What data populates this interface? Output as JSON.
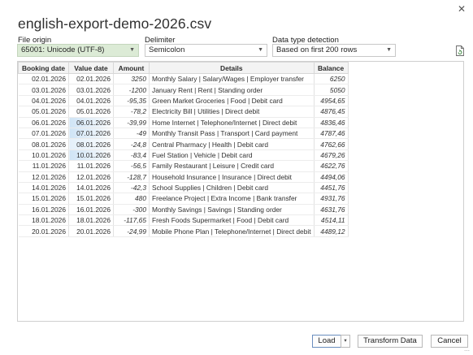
{
  "window": {
    "title": "english-export-demo-2026.csv",
    "close_glyph": "✕"
  },
  "file_origin": {
    "label": "File origin",
    "value": "65001: Unicode (UTF-8)"
  },
  "delimiter": {
    "label": "Delimiter",
    "value": "Semicolon"
  },
  "detection": {
    "label": "Data type detection",
    "value": "Based on first 200 rows"
  },
  "refresh_icon": "document-refresh-icon",
  "table": {
    "headers": [
      "Booking date",
      "Value date",
      "Amount",
      "Details",
      "Balance"
    ],
    "rows": [
      [
        "02.01.2026",
        "02.01.2026",
        "3250",
        "Monthly Salary | Salary/Wages | Employer transfer",
        "6250"
      ],
      [
        "03.01.2026",
        "03.01.2026",
        "-1200",
        "January Rent | Rent | Standing order",
        "5050"
      ],
      [
        "04.01.2026",
        "04.01.2026",
        "-95,35",
        "Green Market Groceries | Food | Debit card",
        "4954,65"
      ],
      [
        "05.01.2026",
        "05.01.2026",
        "-78,2",
        "Electricity Bill | Utilities | Direct debit",
        "4876,45"
      ],
      [
        "06.01.2026",
        "06.01.2026",
        "-39,99",
        "Home Internet | Telephone/Internet | Direct debit",
        "4836,46"
      ],
      [
        "07.01.2026",
        "07.01.2026",
        "-49",
        "Monthly Transit Pass | Transport | Card payment",
        "4787,46"
      ],
      [
        "08.01.2026",
        "08.01.2026",
        "-24,8",
        "Central Pharmacy | Health | Debit card",
        "4762,66"
      ],
      [
        "10.01.2026",
        "10.01.2026",
        "-83,4",
        "Fuel Station | Vehicle | Debit card",
        "4679,26"
      ],
      [
        "11.01.2026",
        "11.01.2026",
        "-56,5",
        "Family Restaurant | Leisure | Credit card",
        "4622,76"
      ],
      [
        "12.01.2026",
        "12.01.2026",
        "-128,7",
        "Household Insurance | Insurance | Direct debit",
        "4494,06"
      ],
      [
        "14.01.2026",
        "14.01.2026",
        "-42,3",
        "School Supplies | Children | Debit card",
        "4451,76"
      ],
      [
        "15.01.2026",
        "15.01.2026",
        "480",
        "Freelance Project | Extra Income | Bank transfer",
        "4931,76"
      ],
      [
        "16.01.2026",
        "16.01.2026",
        "-300",
        "Monthly Savings | Savings | Standing order",
        "4631,76"
      ],
      [
        "18.01.2026",
        "18.01.2026",
        "-117,65",
        "Fresh Foods Supermarket | Food | Debit card",
        "4514,11"
      ],
      [
        "20.01.2026",
        "20.01.2026",
        "-24,99",
        "Mobile Phone Plan | Telephone/Internet | Direct debit",
        "4489,12"
      ]
    ]
  },
  "buttons": {
    "load": "Load",
    "load_split_glyph": "▾",
    "transform": "Transform Data",
    "cancel": "Cancel"
  },
  "colors": {
    "focus_dropdown_bg": "#dcebd6",
    "value_date_highlight": "#cfe4f6",
    "primary_button_border": "#6a8ebf"
  }
}
